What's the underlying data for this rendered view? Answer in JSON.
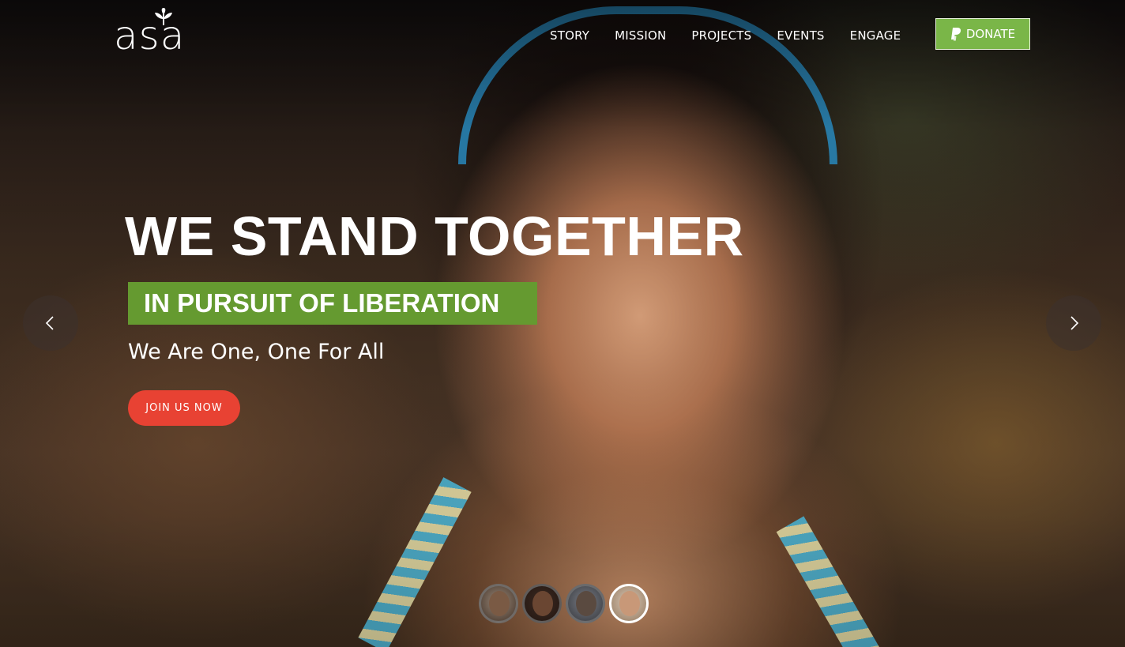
{
  "logo": {
    "text": "asa"
  },
  "nav": {
    "items": [
      {
        "label": "STORY"
      },
      {
        "label": "MISSION"
      },
      {
        "label": "PROJECTS"
      },
      {
        "label": "EVENTS"
      },
      {
        "label": "ENGAGE"
      }
    ]
  },
  "donate": {
    "label": "DONATE",
    "icon": "paypal-icon",
    "color": "#7ab648"
  },
  "hero": {
    "headline": "WE STAND TOGETHER",
    "tagline": "IN PURSUIT OF LIBERATION",
    "tagline_bg": "#659a30",
    "subline": "We Are One, One For All",
    "cta": {
      "label": "JOIN US NOW",
      "color": "#e84233"
    }
  },
  "slider": {
    "prev_icon": "chevron-left-icon",
    "next_icon": "chevron-right-icon",
    "thumbnails": [
      {
        "name": "slide-1",
        "active": false
      },
      {
        "name": "slide-2",
        "active": false
      },
      {
        "name": "slide-3",
        "active": false
      },
      {
        "name": "slide-4",
        "active": true
      }
    ]
  }
}
